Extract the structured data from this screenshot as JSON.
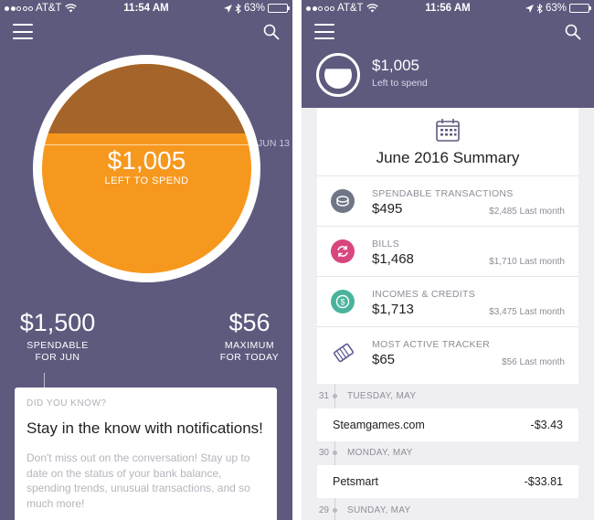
{
  "colors": {
    "header_purple": "#5d5a7e",
    "gauge_orange": "#f7981e",
    "gauge_spent": "#a5652a",
    "icon_spendable": "#6f7686",
    "icon_bills": "#d8467f",
    "icon_incomes": "#4bb39d",
    "icon_tracker": "#5b5d92"
  },
  "left": {
    "status": {
      "carrier": "AT&T",
      "time": "11:54 AM",
      "battery": "63%",
      "battery_level": 0.63
    },
    "gauge": {
      "date": "JUN 13",
      "amount": "$1,005",
      "label": "LEFT TO SPEND",
      "spent_fraction": 0.33
    },
    "stats": {
      "spendable_amount": "$1,500",
      "spendable_label_1": "SPENDABLE",
      "spendable_label_2": "FOR JUN",
      "max_amount": "$56",
      "max_label_1": "MAXIMUM",
      "max_label_2": "FOR TODAY"
    },
    "card": {
      "eyebrow": "DID YOU KNOW?",
      "headline": "Stay in the know with notifications!",
      "body": "Don't miss out on the conversation! Stay up to date on the status of your bank balance, spending trends, unusual transactions, and so much more!"
    }
  },
  "right": {
    "status": {
      "carrier": "AT&T",
      "time": "11:56 AM",
      "battery": "63%",
      "battery_level": 0.63
    },
    "header": {
      "amount": "$1,005",
      "label": "Left to spend"
    },
    "summary": {
      "title": "June 2016 Summary",
      "rows": [
        {
          "label": "SPENDABLE TRANSACTIONS",
          "value": "$495",
          "compare": "$2,485 Last month",
          "icon": "coin-stack-icon"
        },
        {
          "label": "BILLS",
          "value": "$1,468",
          "compare": "$1,710 Last month",
          "icon": "refresh-icon"
        },
        {
          "label": "INCOMES & CREDITS",
          "value": "$1,713",
          "compare": "$3,475 Last month",
          "icon": "dollar-coin-icon"
        },
        {
          "label": "MOST ACTIVE TRACKER",
          "value": "$65",
          "compare": "$56 Last month",
          "icon": "ticket-icon"
        }
      ]
    },
    "timeline": [
      {
        "day": "31",
        "label": "TUESDAY, MAY",
        "merchant": "Steamgames.com",
        "amount": "-$3.43"
      },
      {
        "day": "30",
        "label": "MONDAY, MAY",
        "merchant": "Petsmart",
        "amount": "-$33.81"
      },
      {
        "day": "29",
        "label": "SUNDAY, MAY"
      }
    ]
  }
}
